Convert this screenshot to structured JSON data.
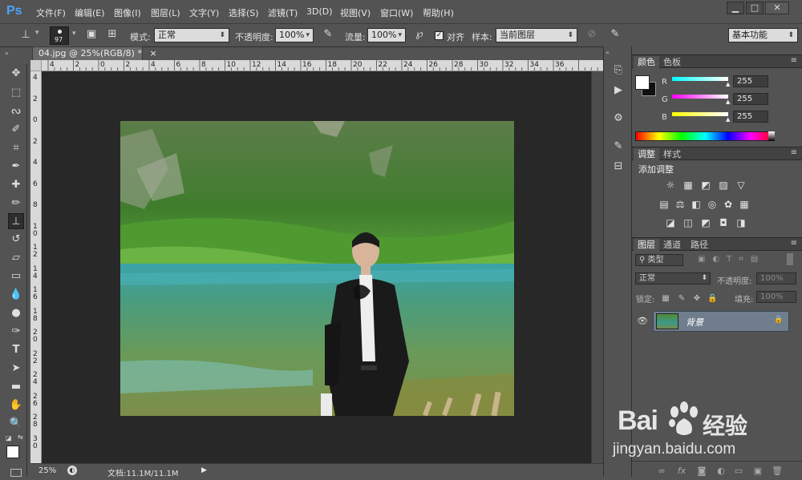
{
  "app": {
    "logo": "Ps"
  },
  "menu": [
    "文件(F)",
    "编辑(E)",
    "图像(I)",
    "图层(L)",
    "文字(Y)",
    "选择(S)",
    "滤镜(T)",
    "3D(D)",
    "视图(V)",
    "窗口(W)",
    "帮助(H)"
  ],
  "window_controls": {
    "minimize": "▁",
    "maximize": "□",
    "close": "✕"
  },
  "options": {
    "brush_size": "97",
    "mode_label": "模式:",
    "mode_value": "正常",
    "opacity_label": "不透明度:",
    "opacity_value": "100%",
    "flow_label": "流量:",
    "flow_value": "100%",
    "align_label": "对齐",
    "align_checked": true,
    "sample_label": "样本:",
    "sample_value": "当前图层",
    "workspace_value": "基本功能"
  },
  "document": {
    "tab_title": "04.jpg @ 25%(RGB/8) *",
    "tab_close": "×",
    "ruler_h": [
      "4",
      "2",
      "0",
      "2",
      "4",
      "6",
      "8",
      "10",
      "12",
      "14",
      "16",
      "18",
      "20",
      "22",
      "24",
      "26",
      "28",
      "30",
      "32",
      "34",
      "36"
    ],
    "ruler_v": [
      "4",
      "2",
      "0",
      "2",
      "4",
      "6",
      "8",
      "10",
      "12",
      "14",
      "16",
      "18",
      "20",
      "22",
      "24",
      "26",
      "28",
      "30"
    ],
    "zoom": "25%",
    "doc_info": "文档:11.1M/11.1M"
  },
  "color_panel": {
    "tabs": [
      "颜色",
      "色板"
    ],
    "channels": [
      {
        "name": "R",
        "value": "255",
        "gradient": "linear-gradient(to right,#00ffff,#ffffff)"
      },
      {
        "name": "G",
        "value": "255",
        "gradient": "linear-gradient(to right,#ff00ff,#ffffff)"
      },
      {
        "name": "B",
        "value": "255",
        "gradient": "linear-gradient(to right,#ffff00,#ffffff)"
      }
    ]
  },
  "adjust_panel": {
    "tabs": [
      "调整",
      "样式"
    ],
    "heading": "添加调整",
    "row1": [
      "☼",
      "▦",
      "◩",
      "▨",
      "▽"
    ],
    "row2": [
      "▤",
      "⚖",
      "◧",
      "◎",
      "✿",
      "▦"
    ],
    "row3": [
      "◪",
      "◫",
      "◩",
      "◘",
      "◨"
    ]
  },
  "layers_panel": {
    "tabs": [
      "图层",
      "通道",
      "路径"
    ],
    "filter_value": "类型",
    "blend_value": "正常",
    "opacity_label": "不透明度:",
    "opacity_value": "100%",
    "lock_label": "锁定:",
    "fill_label": "填充:",
    "fill_value": "100%",
    "layer_name": "背景",
    "bottom_icons": [
      "∞",
      "fx",
      "◙",
      "◐",
      "▭",
      "▣",
      "🗑"
    ]
  },
  "watermark": {
    "brand": "Bai",
    "brand2": "经验",
    "url": "jingyan.baidu.com"
  },
  "colors": {
    "panel_bg": "#535353",
    "canvas_bg": "#282828",
    "selected_layer": "#6f7d8c"
  }
}
